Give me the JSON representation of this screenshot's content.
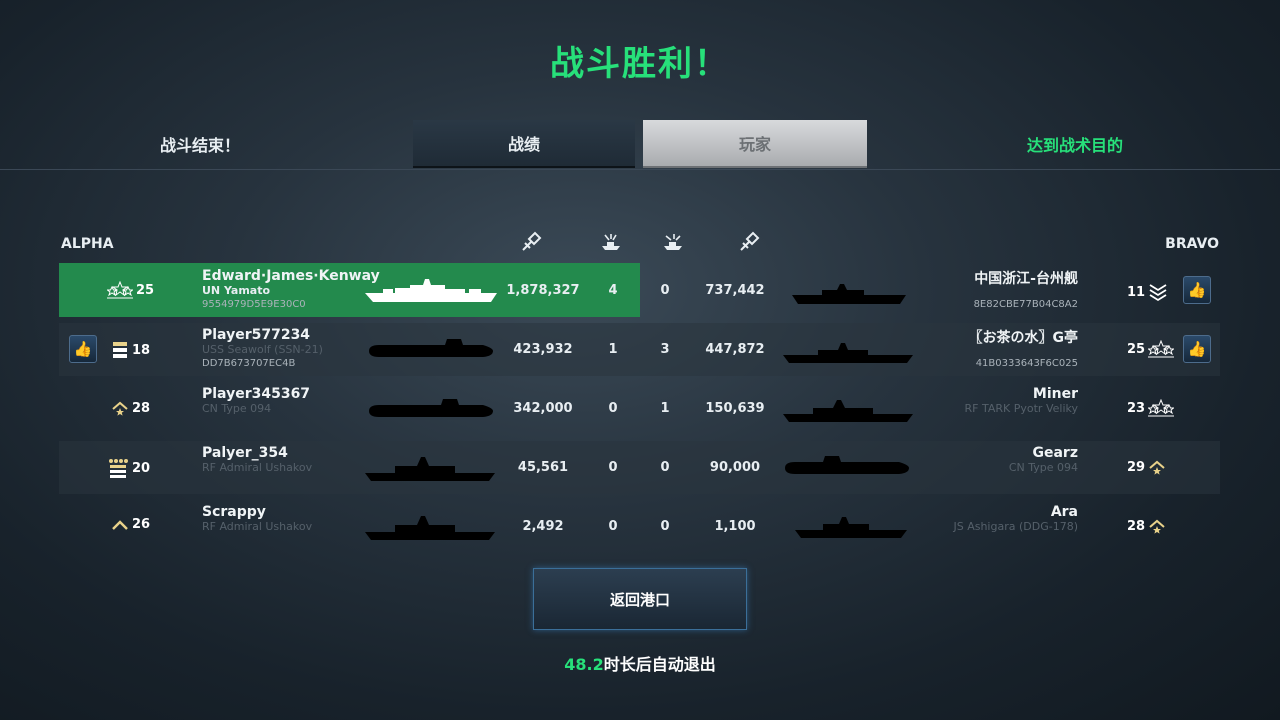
{
  "title": "战斗胜利！",
  "tabs": {
    "left_label": "战斗结束！",
    "stats_label": "战绩",
    "players_label": "玩家",
    "right_label": "达到战术目的"
  },
  "teams": {
    "alpha": "ALPHA",
    "bravo": "BRAVO"
  },
  "header_icons": [
    "damage-dealt-icon",
    "ships-destroyed-icon",
    "ships-lost-icon",
    "damage-received-icon"
  ],
  "rows": [
    {
      "left": {
        "level": "25",
        "rank_icon": "three-stars-rank-icon",
        "name": "Edward·James·Kenway",
        "ship": "UN Yamato",
        "id": "9554979D5E9E30C0",
        "liked": false
      },
      "stats": {
        "c1": "1,878,327",
        "c2": "4",
        "c3": "0",
        "c4": "737,442"
      },
      "right": {
        "level": "11",
        "rank_icon": "chevron-stack-rank-icon",
        "name": "中国浙江-台州舰",
        "ship": "",
        "id": "8E82CBE77B04C8A2",
        "liked": true
      }
    },
    {
      "left": {
        "level": "18",
        "rank_icon": "bars-rank-icon",
        "name": "Player577234",
        "ship": "USS Seawolf (SSN-21)",
        "id": "DD7B673707EC4B",
        "liked": true
      },
      "stats": {
        "c1": "423,932",
        "c2": "1",
        "c3": "3",
        "c4": "447,872"
      },
      "right": {
        "level": "25",
        "rank_icon": "three-stars-rank-icon",
        "name": "〖お茶の水〗G亭",
        "ship": "",
        "id": "41B0333643F6C025",
        "liked": true
      }
    },
    {
      "left": {
        "level": "28",
        "rank_icon": "chevron-star-rank-icon",
        "name": "Player345367",
        "ship": "CN Type 094",
        "id": "",
        "liked": false
      },
      "stats": {
        "c1": "342,000",
        "c2": "0",
        "c3": "1",
        "c4": "150,639"
      },
      "right": {
        "level": "23",
        "rank_icon": "three-stars-rank-icon",
        "name": "Miner",
        "ship": "RF TARK Pyotr Veliky",
        "id": "",
        "liked": false
      }
    },
    {
      "left": {
        "level": "20",
        "rank_icon": "bars-stars-rank-icon",
        "name": "Palyer_354",
        "ship": "RF Admiral Ushakov",
        "id": "",
        "liked": false
      },
      "stats": {
        "c1": "45,561",
        "c2": "0",
        "c3": "0",
        "c4": "90,000"
      },
      "right": {
        "level": "29",
        "rank_icon": "chevron-star-rank-icon",
        "name": "Gearz",
        "ship": "CN Type 094",
        "id": "",
        "liked": false
      }
    },
    {
      "left": {
        "level": "26",
        "rank_icon": "chevron-rank-icon",
        "name": "Scrappy",
        "ship": "RF Admiral Ushakov",
        "id": "",
        "liked": false
      },
      "stats": {
        "c1": "2,492",
        "c2": "0",
        "c3": "0",
        "c4": "1,100"
      },
      "right": {
        "level": "28",
        "rank_icon": "chevron-star-rank-icon",
        "name": "Ara",
        "ship": "JS Ashigara (DDG-178)",
        "id": "",
        "liked": false
      }
    }
  ],
  "return_button": "返回港口",
  "auto_exit": {
    "seconds": "48.2",
    "text": "时长后自动退出"
  },
  "colors": {
    "accent_green": "#27e07a",
    "highlight_row": "#238a4d"
  }
}
